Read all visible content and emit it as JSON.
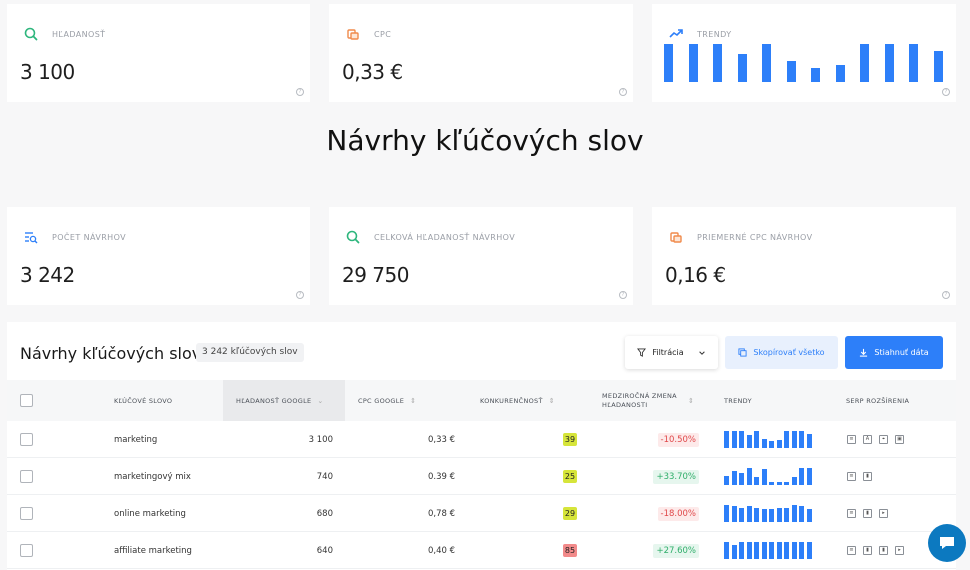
{
  "stats_top": [
    {
      "label": "HĽADANOSŤ",
      "value": "3 100",
      "icon": "search-icon",
      "color": "#2eb67d"
    },
    {
      "label": "CPC",
      "value": "0,33 €",
      "icon": "coins-icon",
      "color": "#f08a4b"
    },
    {
      "label": "TRENDY",
      "icon": "trend-up-icon",
      "color": "#2d7ff9",
      "bars": [
        1.0,
        1.0,
        1.0,
        0.73,
        1.0,
        0.55,
        0.36,
        0.45,
        1.0,
        1.0,
        1.0,
        0.82
      ]
    }
  ],
  "page_title": "Návrhy kľúčových slov",
  "stats_bottom": [
    {
      "label": "POČET NÁVRHOV",
      "value": "3 242",
      "icon": "list-search-icon",
      "color": "#2d7ff9"
    },
    {
      "label": "CELKOVÁ HĽADANOSŤ NÁVRHOV",
      "value": "29 750",
      "icon": "search-icon",
      "color": "#2eb67d"
    },
    {
      "label": "PRIEMERNÉ CPC NÁVRHOV",
      "value": "0,16 €",
      "icon": "coins-icon",
      "color": "#f08a4b"
    }
  ],
  "table_panel": {
    "title": "Návrhy kľúčových slov",
    "count_badge": "3 242  kľúčových slov",
    "filter_label": "Filtrácia",
    "copy_label": "Skopírovať všetko",
    "download_label": "Stiahnuť dáta",
    "columns": [
      "KĽÚČOVÉ SLOVO",
      "HĽADANOSŤ GOOGLE",
      "CPC GOOGLE",
      "KONKURENČNOSŤ",
      "MEDZIROČNÁ ZMENA HĽADANOSTI",
      "TRENDY",
      "SERP ROZŠÍRENIA"
    ],
    "rows": [
      {
        "keyword": "marketing",
        "volume": "3 100",
        "cpc": "0,33 €",
        "kd": "39",
        "kd_color": "yellow",
        "change": "-10.50%",
        "change_dir": "neg",
        "trend": [
          1.0,
          1.0,
          1.0,
          0.78,
          1.0,
          0.55,
          0.4,
          0.5,
          1.0,
          1.0,
          1.0,
          0.85
        ],
        "serp": [
          "snippet-icon",
          "ads-icon",
          "map-pin-icon",
          "image-icon"
        ]
      },
      {
        "keyword": "marketingový mix",
        "volume": "740",
        "cpc": "0.39 €",
        "kd": "25",
        "kd_color": "yellow",
        "change": "+33.70%",
        "change_dir": "pos",
        "trend": [
          0.55,
          0.8,
          0.7,
          1.0,
          0.5,
          0.95,
          0.2,
          0.15,
          0.2,
          0.45,
          1.0,
          1.0
        ],
        "serp": [
          "snippet-icon",
          "bookmark-icon"
        ]
      },
      {
        "keyword": "online marketing",
        "volume": "680",
        "cpc": "0,78 €",
        "kd": "29",
        "kd_color": "yellow",
        "change": "-18.00%",
        "change_dir": "neg",
        "trend": [
          1.0,
          0.95,
          0.85,
          0.95,
          0.85,
          0.75,
          0.75,
          0.85,
          0.85,
          1.0,
          0.95,
          0.75
        ],
        "serp": [
          "snippet-icon",
          "bookmark-icon",
          "video-icon"
        ]
      },
      {
        "keyword": "affiliate marketing",
        "volume": "640",
        "cpc": "0,40 €",
        "kd": "85",
        "kd_color": "red",
        "change": "+27.60%",
        "change_dir": "pos",
        "trend": [
          1.0,
          0.85,
          1.0,
          1.0,
          1.0,
          1.0,
          1.0,
          1.0,
          1.0,
          1.0,
          1.0,
          1.0
        ],
        "serp": [
          "snippet-icon",
          "bookmark-icon",
          "bookmark-icon",
          "video-icon"
        ]
      }
    ]
  },
  "help_glyph": "?"
}
